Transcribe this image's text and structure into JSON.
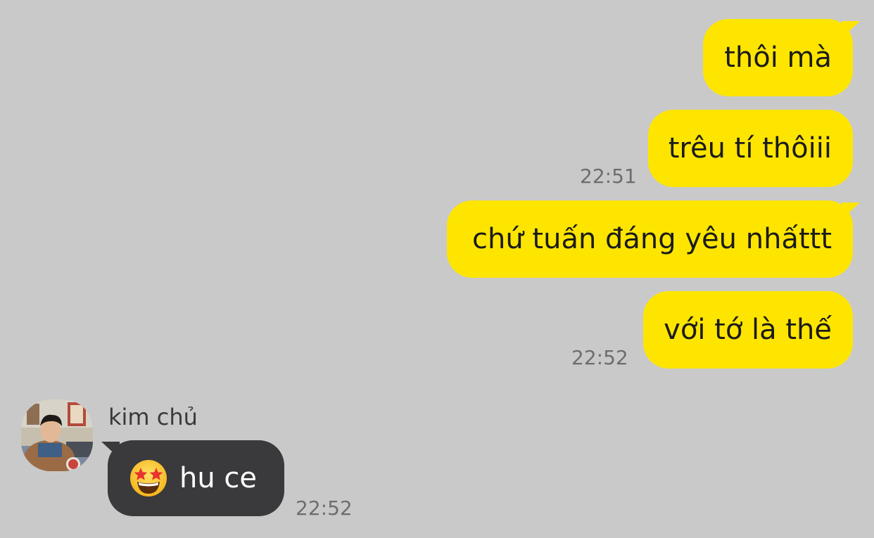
{
  "outgoing": [
    {
      "text": "thôi mà",
      "time": ""
    },
    {
      "text": "trêu tí thôiii",
      "time": "22:51"
    },
    {
      "text": "chứ tuấn đáng yêu nhấttt",
      "time": ""
    },
    {
      "text": "với tớ là thế",
      "time": "22:52"
    }
  ],
  "incoming": {
    "sender": "kim chủ",
    "emoji": "star-struck-emoji",
    "text": "hu ce",
    "time": "22:52"
  },
  "colors": {
    "background": "#c9c9c9",
    "outgoing_bubble": "#fee500",
    "incoming_bubble": "#3a3a3c",
    "timestamp": "#6d6d6d"
  }
}
